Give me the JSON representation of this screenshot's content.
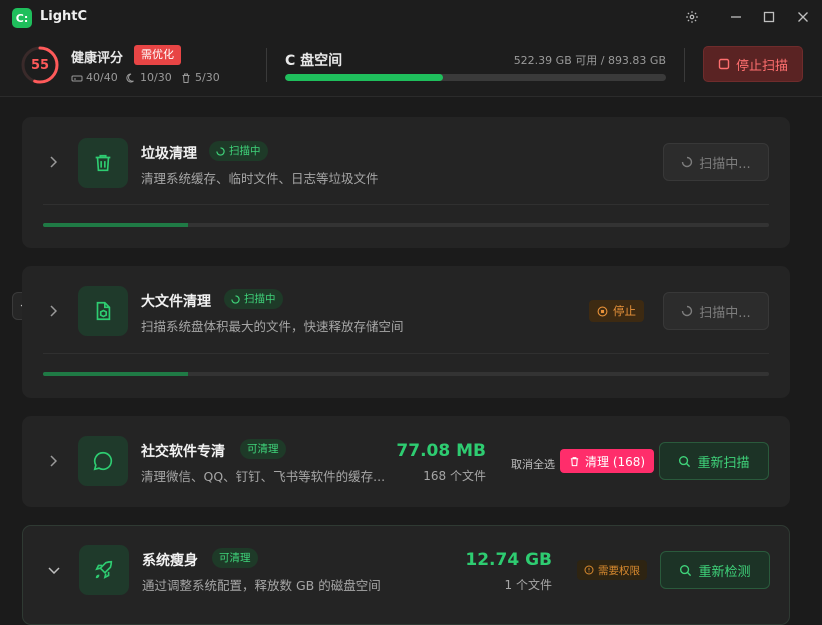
{
  "app": {
    "logo_letter": "C:",
    "title": "LightC"
  },
  "window": {
    "settings_icon": "gear-icon",
    "minimize_icon": "minimize-icon",
    "maximize_icon": "maximize-icon",
    "close_icon": "close-icon"
  },
  "header": {
    "score": "55",
    "score_fraction": 0.55,
    "health_label": "健康评分",
    "status_badge": "需优化",
    "stats": [
      {
        "icon": "drive-icon",
        "value": "40/40"
      },
      {
        "icon": "moon-icon",
        "value": "10/30"
      },
      {
        "icon": "trash-icon",
        "value": "5/30"
      }
    ],
    "disk_title": "C 盘空间",
    "disk_info": "522.39 GB 可用 / 893.83 GB",
    "disk_used_fraction": 0.416,
    "stop_scan_label": "停止扫描"
  },
  "colors": {
    "accent": "#1fbf5c",
    "danger": "#e84545",
    "pink": "#ff2d6b",
    "warn": "#e8923a"
  },
  "cards": [
    {
      "title": "垃圾清理",
      "tag": "扫描中",
      "desc": "清理系统缓存、临时文件、日志等垃圾文件",
      "button": "扫描中...",
      "progress": 0.2
    },
    {
      "title": "大文件清理",
      "tag": "扫描中",
      "desc": "扫描系统盘体积最大的文件，快速释放存储空间",
      "stop_label": "停止",
      "button": "扫描中...",
      "progress": 0.2
    },
    {
      "title": "社交软件专清",
      "tag": "可清理",
      "desc": "清理微信、QQ、钉钉、飞书等软件的缓存...",
      "size": "77.08 MB",
      "count": "168 个文件",
      "deselect": "取消全选",
      "clean_label": "清理 (168)",
      "button": "重新扫描"
    },
    {
      "title": "系统瘦身",
      "tag": "可清理",
      "desc": "通过调整系统配置，释放数 GB 的磁盘空间",
      "size": "12.74 GB",
      "count": "1 个文件",
      "perm_label": "需要权限",
      "button": "重新检测"
    }
  ]
}
